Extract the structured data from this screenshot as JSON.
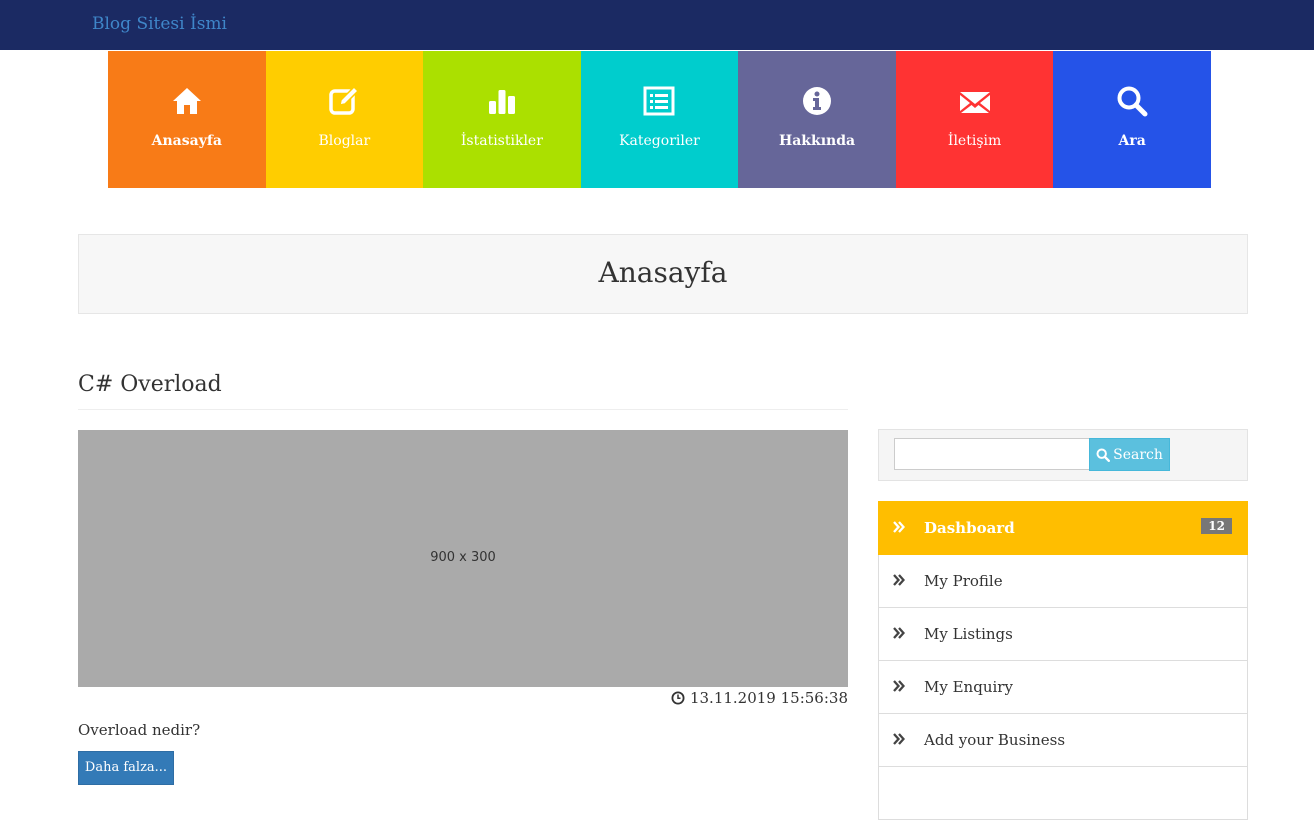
{
  "header": {
    "brand": "Blog Sitesi İsmi",
    "brand_color": "#3f86c9",
    "bar_color": "#1b2a63"
  },
  "nav": [
    {
      "label": "Anasayfa",
      "icon": "home-icon",
      "color": "#f87b17"
    },
    {
      "label": "Bloglar",
      "icon": "edit-icon",
      "color": "#ffcd00"
    },
    {
      "label": "İstatistikler",
      "icon": "bar-chart-icon",
      "color": "#abe000"
    },
    {
      "label": "Kategoriler",
      "icon": "list-icon",
      "color": "#00cdcd"
    },
    {
      "label": "Hakkında",
      "icon": "info-icon",
      "color": "#666699"
    },
    {
      "label": "İletişim",
      "icon": "envelope-icon",
      "color": "#ff3333"
    },
    {
      "label": "Ara",
      "icon": "search-icon",
      "color": "#2553e8"
    }
  ],
  "page": {
    "title": "Anasayfa"
  },
  "post": {
    "title": "C# Overload",
    "image_placeholder": "900 x 300",
    "date": "13.11.2019 15:56:38",
    "excerpt": "Overload nedir?",
    "more_label": "Daha falza..."
  },
  "sidebar": {
    "search": {
      "value": "",
      "button_label": "Search"
    },
    "menu": [
      {
        "label": "Dashboard",
        "badge": "12",
        "active": true
      },
      {
        "label": "My Profile"
      },
      {
        "label": "My Listings"
      },
      {
        "label": "My Enquiry"
      },
      {
        "label": "Add your Business"
      }
    ],
    "active_color": "#ffbe00"
  }
}
